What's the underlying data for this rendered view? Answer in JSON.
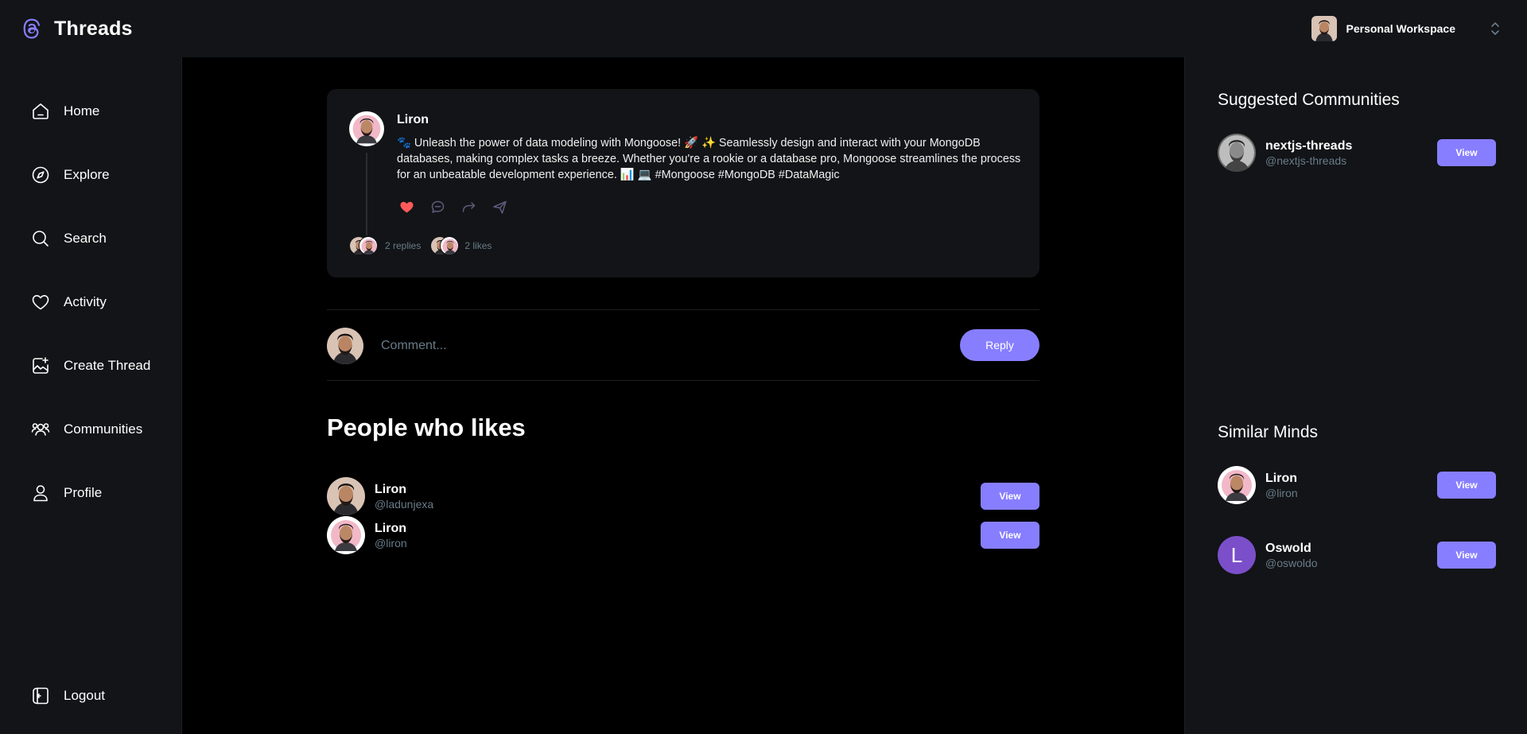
{
  "header": {
    "app_name": "Threads",
    "workspace_label": "Personal Workspace"
  },
  "sidebar": {
    "items": [
      {
        "label": "Home",
        "icon": "home-icon"
      },
      {
        "label": "Explore",
        "icon": "compass-icon"
      },
      {
        "label": "Search",
        "icon": "search-icon"
      },
      {
        "label": "Activity",
        "icon": "heart-icon"
      },
      {
        "label": "Create Thread",
        "icon": "image-plus-icon"
      },
      {
        "label": "Communities",
        "icon": "users-icon"
      },
      {
        "label": "Profile",
        "icon": "user-icon"
      }
    ],
    "logout_label": "Logout"
  },
  "thread": {
    "author": "Liron",
    "text": "🐾 Unleash the power of data modeling with Mongoose! 🚀 ✨ Seamlessly design and interact with your MongoDB databases, making complex tasks a breeze. Whether you're a rookie or a database pro, Mongoose streamlines the process for an unbeatable development experience. 📊 💻 #Mongoose #MongoDB #DataMagic",
    "replies_label": "2 replies",
    "likes_label": "2 likes",
    "liked": true
  },
  "comment": {
    "placeholder": "Comment...",
    "reply_label": "Reply"
  },
  "likes": {
    "title": "People who likes",
    "people": [
      {
        "name": "Liron",
        "handle": "@ladunjexa",
        "button": "View"
      },
      {
        "name": "Liron",
        "handle": "@liron",
        "button": "View"
      }
    ]
  },
  "right": {
    "suggested_title": "Suggested Communities",
    "communities": [
      {
        "name": "nextjs-threads",
        "handle": "@nextjs-threads",
        "button": "View"
      }
    ],
    "similar_title": "Similar Minds",
    "users": [
      {
        "name": "Liron",
        "handle": "@liron",
        "button": "View"
      },
      {
        "name": "Oswold",
        "handle": "@oswoldo",
        "button": "View",
        "initial": "L"
      }
    ]
  },
  "colors": {
    "accent": "#877eff",
    "panel": "#121417",
    "muted": "#697c89",
    "like": "#ff5a5a"
  }
}
